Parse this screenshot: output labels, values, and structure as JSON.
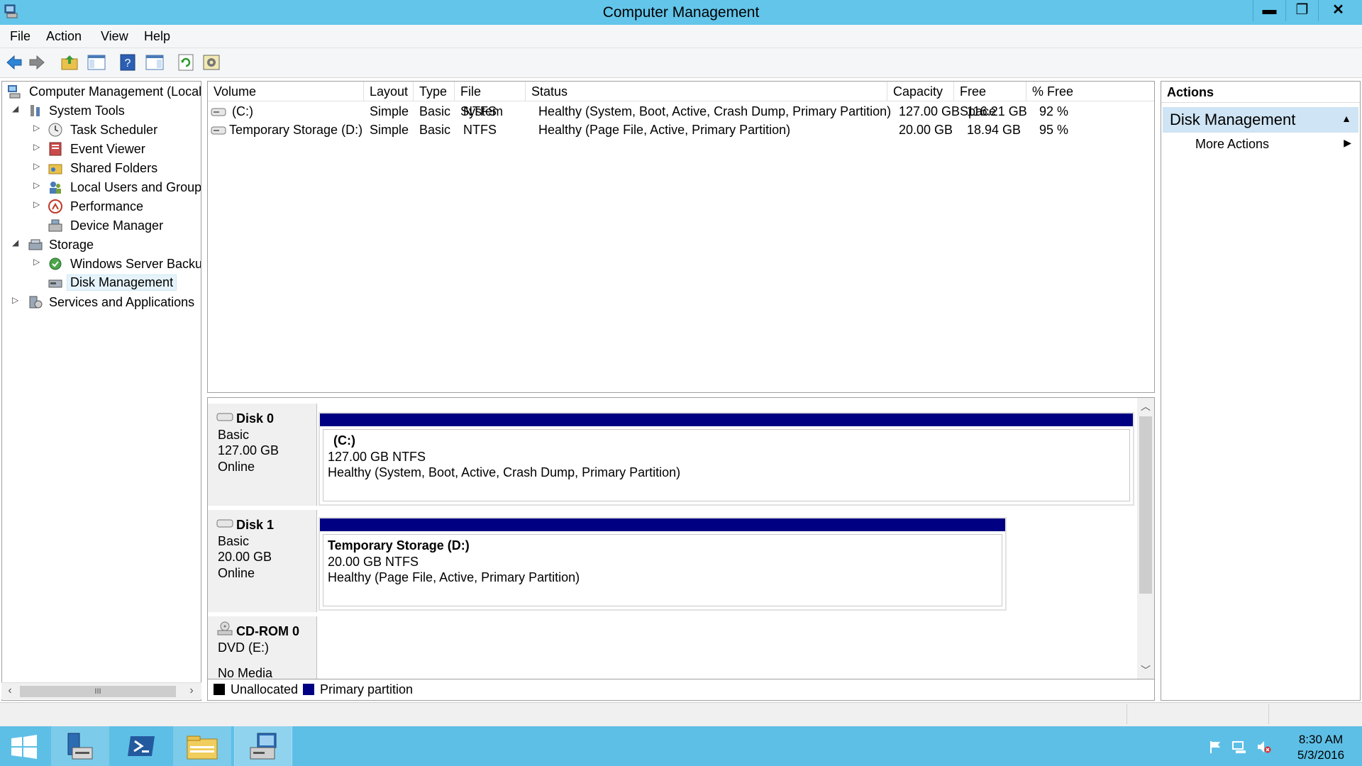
{
  "window": {
    "title": "Computer Management",
    "minimize_glyph": "▬",
    "restore_glyph": "❐",
    "close_glyph": "✕"
  },
  "menu": [
    "File",
    "Action",
    "View",
    "Help"
  ],
  "toolbar": {
    "icons": [
      "back-icon",
      "forward-icon",
      "up-folder-icon",
      "show-hide-console-tree-icon",
      "help-icon",
      "show-hide-action-pane-icon",
      "refresh-icon",
      "settings-icon"
    ]
  },
  "tree": {
    "root": "Computer Management (Local",
    "system_tools": "System Tools",
    "task_scheduler": "Task Scheduler",
    "event_viewer": "Event Viewer",
    "shared_folders": "Shared Folders",
    "local_users": "Local Users and Groups",
    "performance": "Performance",
    "device_manager": "Device Manager",
    "storage": "Storage",
    "windows_server_backup": "Windows Server Backup",
    "disk_management": "Disk Management",
    "services_apps": "Services and Applications",
    "scroll_thumb": "III"
  },
  "volumes": {
    "columns": [
      "Volume",
      "Layout",
      "Type",
      "File System",
      "Status",
      "Capacity",
      "Free Space",
      "% Free"
    ],
    "rows": [
      {
        "volume": "(C:)",
        "layout": "Simple",
        "type": "Basic",
        "fs": "NTFS",
        "status": "Healthy (System, Boot, Active, Crash Dump, Primary Partition)",
        "capacity": "127.00 GB",
        "free": "116.21 GB",
        "pct": "92 %"
      },
      {
        "volume": "Temporary Storage (D:)",
        "layout": "Simple",
        "type": "Basic",
        "fs": "NTFS",
        "status": "Healthy (Page File, Active, Primary Partition)",
        "capacity": "20.00 GB",
        "free": "18.94 GB",
        "pct": "95 %"
      }
    ]
  },
  "disks": [
    {
      "name": "Disk 0",
      "type": "Basic",
      "size": "127.00 GB",
      "state": "Online",
      "partition": {
        "name": "(C:)",
        "size_fs": "127.00 GB NTFS",
        "status": "Healthy (System, Boot, Active, Crash Dump, Primary Partition)"
      }
    },
    {
      "name": "Disk 1",
      "type": "Basic",
      "size": "20.00 GB",
      "state": "Online",
      "partition": {
        "name": "Temporary Storage  (D:)",
        "size_fs": "20.00 GB NTFS",
        "status": "Healthy (Page File, Active, Primary Partition)"
      }
    },
    {
      "name": "CD-ROM 0",
      "type": "DVD (E:)",
      "state": "No Media"
    }
  ],
  "legend": {
    "unallocated": "Unallocated",
    "primary": "Primary partition",
    "unallocated_color": "#000000",
    "primary_color": "#000082"
  },
  "actions": {
    "header": "Actions",
    "section": "Disk Management",
    "more": "More Actions"
  },
  "taskbar": {
    "time": "8:30 AM",
    "date": "5/3/2016",
    "apps": [
      "start-icon",
      "server-manager-icon",
      "powershell-icon",
      "file-explorer-icon",
      "computer-management-icon"
    ]
  },
  "colors": {
    "titlebar": "#63c5ea",
    "taskbar": "#5ebfe6",
    "partition_bar": "#000082",
    "actions_section": "#cfe4f4"
  }
}
